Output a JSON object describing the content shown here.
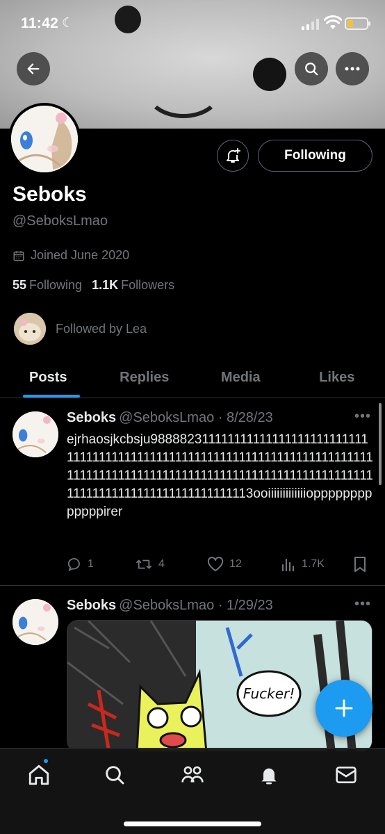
{
  "status_bar": {
    "time": "11:42",
    "battery_color": "#f4c430"
  },
  "profile": {
    "name": "Seboks",
    "handle": "@SeboksLmao",
    "joined": "Joined June 2020",
    "following_count": "55",
    "following_label": "Following",
    "followers_count": "1.1K",
    "followers_label": "Followers",
    "followed_by": "Followed by Lea",
    "follow_button": "Following"
  },
  "tabs": [
    {
      "label": "Posts",
      "active": true
    },
    {
      "label": "Replies",
      "active": false
    },
    {
      "label": "Media",
      "active": false
    },
    {
      "label": "Likes",
      "active": false
    }
  ],
  "posts": [
    {
      "author": "Seboks",
      "meta": "@SeboksLmao · 8/28/23",
      "text": "ejrhaosjkcbsju98888231111111111111111111111111111111111111111111111111111111111111111111111111111111111111111111111111111111111111111111111111111111111111111111111111111113ooiiiiiiiiiiiiiopppppppppppppirer",
      "replies": "1",
      "reposts": "4",
      "likes": "12",
      "views": "1.7K"
    },
    {
      "author": "Seboks",
      "meta": "@SeboksLmao · 1/29/23",
      "image_text": "Fucker!"
    }
  ],
  "colors": {
    "accent": "#1d9bf0",
    "background": "#000000",
    "muted": "#71767b"
  },
  "icons": {
    "back": "arrow-left-icon",
    "search": "search-icon",
    "more": "more-icon",
    "notify": "bell-plus-icon",
    "calendar": "calendar-icon",
    "reply": "reply-icon",
    "repost": "repost-icon",
    "like": "heart-icon",
    "views": "views-icon",
    "bookmark": "bookmark-icon",
    "compose": "plus-icon",
    "home": "home-icon",
    "explore": "search-icon",
    "communities": "communities-icon",
    "notifications": "bell-icon",
    "messages": "mail-icon"
  }
}
